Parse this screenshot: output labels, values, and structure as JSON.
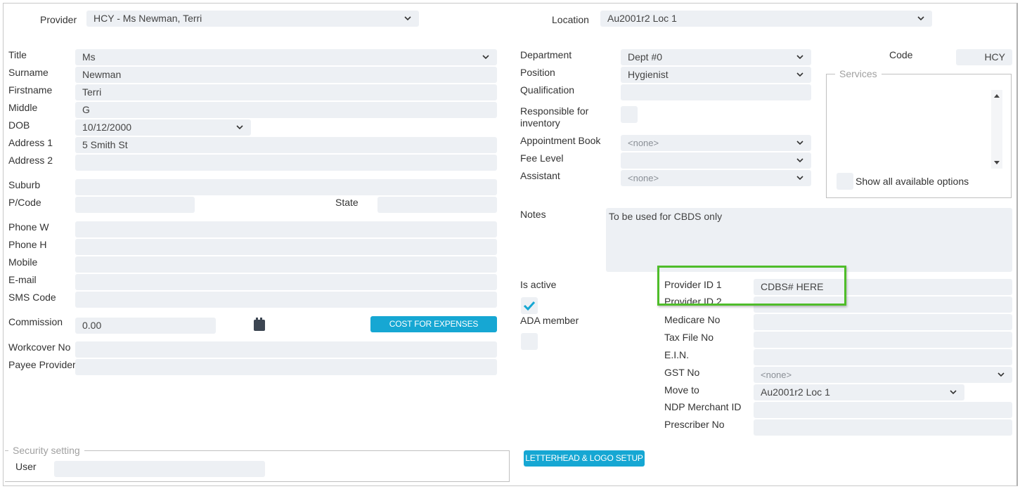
{
  "header": {
    "provider_label": "Provider",
    "provider_value": "HCY - Ms Newman, Terri",
    "location_label": "Location",
    "location_value": "Au2001r2 Loc 1"
  },
  "left": {
    "title_label": "Title",
    "title_value": "Ms",
    "surname_label": "Surname",
    "surname_value": "Newman",
    "firstname_label": "Firstname",
    "firstname_value": "Terri",
    "middle_label": "Middle",
    "middle_value": "G",
    "dob_label": "DOB",
    "dob_value": "10/12/2000",
    "address1_label": "Address 1",
    "address1_value": "5 Smith St",
    "address2_label": "Address 2",
    "address2_value": "",
    "suburb_label": "Suburb",
    "suburb_value": "",
    "pcode_label": "P/Code",
    "pcode_value": "",
    "state_label": "State",
    "state_value": "",
    "phonew_label": "Phone W",
    "phonew_value": "",
    "phoneh_label": "Phone H",
    "phoneh_value": "",
    "mobile_label": "Mobile",
    "mobile_value": "",
    "email_label": "E-mail",
    "email_value": "",
    "smscode_label": "SMS Code",
    "smscode_value": "",
    "commission_label": "Commission",
    "commission_value": "0.00",
    "cost_button": "COST FOR EXPENSES",
    "workcover_label": "Workcover No",
    "workcover_value": "",
    "payee_label": "Payee Provider",
    "payee_value": ""
  },
  "security": {
    "legend": "Security setting",
    "user_label": "User",
    "user_value": ""
  },
  "middle": {
    "department_label": "Department",
    "department_value": "Dept #0",
    "position_label": "Position",
    "position_value": "Hygienist",
    "qualification_label": "Qualification",
    "qualification_value": "",
    "responsible_label_line1": "Responsible for",
    "responsible_label_line2": "inventory",
    "appointment_label": "Appointment Book",
    "appointment_value": "<none>",
    "fee_label": "Fee Level",
    "fee_value": "",
    "assistant_label": "Assistant",
    "assistant_value": "<none>",
    "notes_label": "Notes",
    "notes_value": "To be used for CBDS only",
    "is_active_label": "Is active",
    "is_active_checked": true,
    "ada_label": "ADA member",
    "ada_checked": false,
    "letterhead_button": "LETTERHEAD & LOGO SETUP"
  },
  "right": {
    "code_label": "Code",
    "code_value": "HCY",
    "services_legend": "Services",
    "show_all_label": "Show all available options",
    "provider_id1_label": "Provider ID 1",
    "provider_id1_value": "CDBS# HERE",
    "provider_id2_label": "Provider ID 2",
    "provider_id2_value": "",
    "medicare_label": "Medicare No",
    "medicare_value": "",
    "taxfile_label": "Tax File No",
    "taxfile_value": "",
    "ein_label": "E.I.N.",
    "ein_value": "",
    "gst_label": "GST No",
    "gst_value": "<none>",
    "moveto_label": "Move to",
    "moveto_value": "Au2001r2 Loc 1",
    "ndp_label": "NDP Merchant ID",
    "ndp_value": "",
    "prescriber_label": "Prescriber No",
    "prescriber_value": ""
  },
  "colors": {
    "accent_button": "#16a7d3",
    "highlight_box": "#4fbd2a",
    "field_bg": "#edf0f4"
  }
}
